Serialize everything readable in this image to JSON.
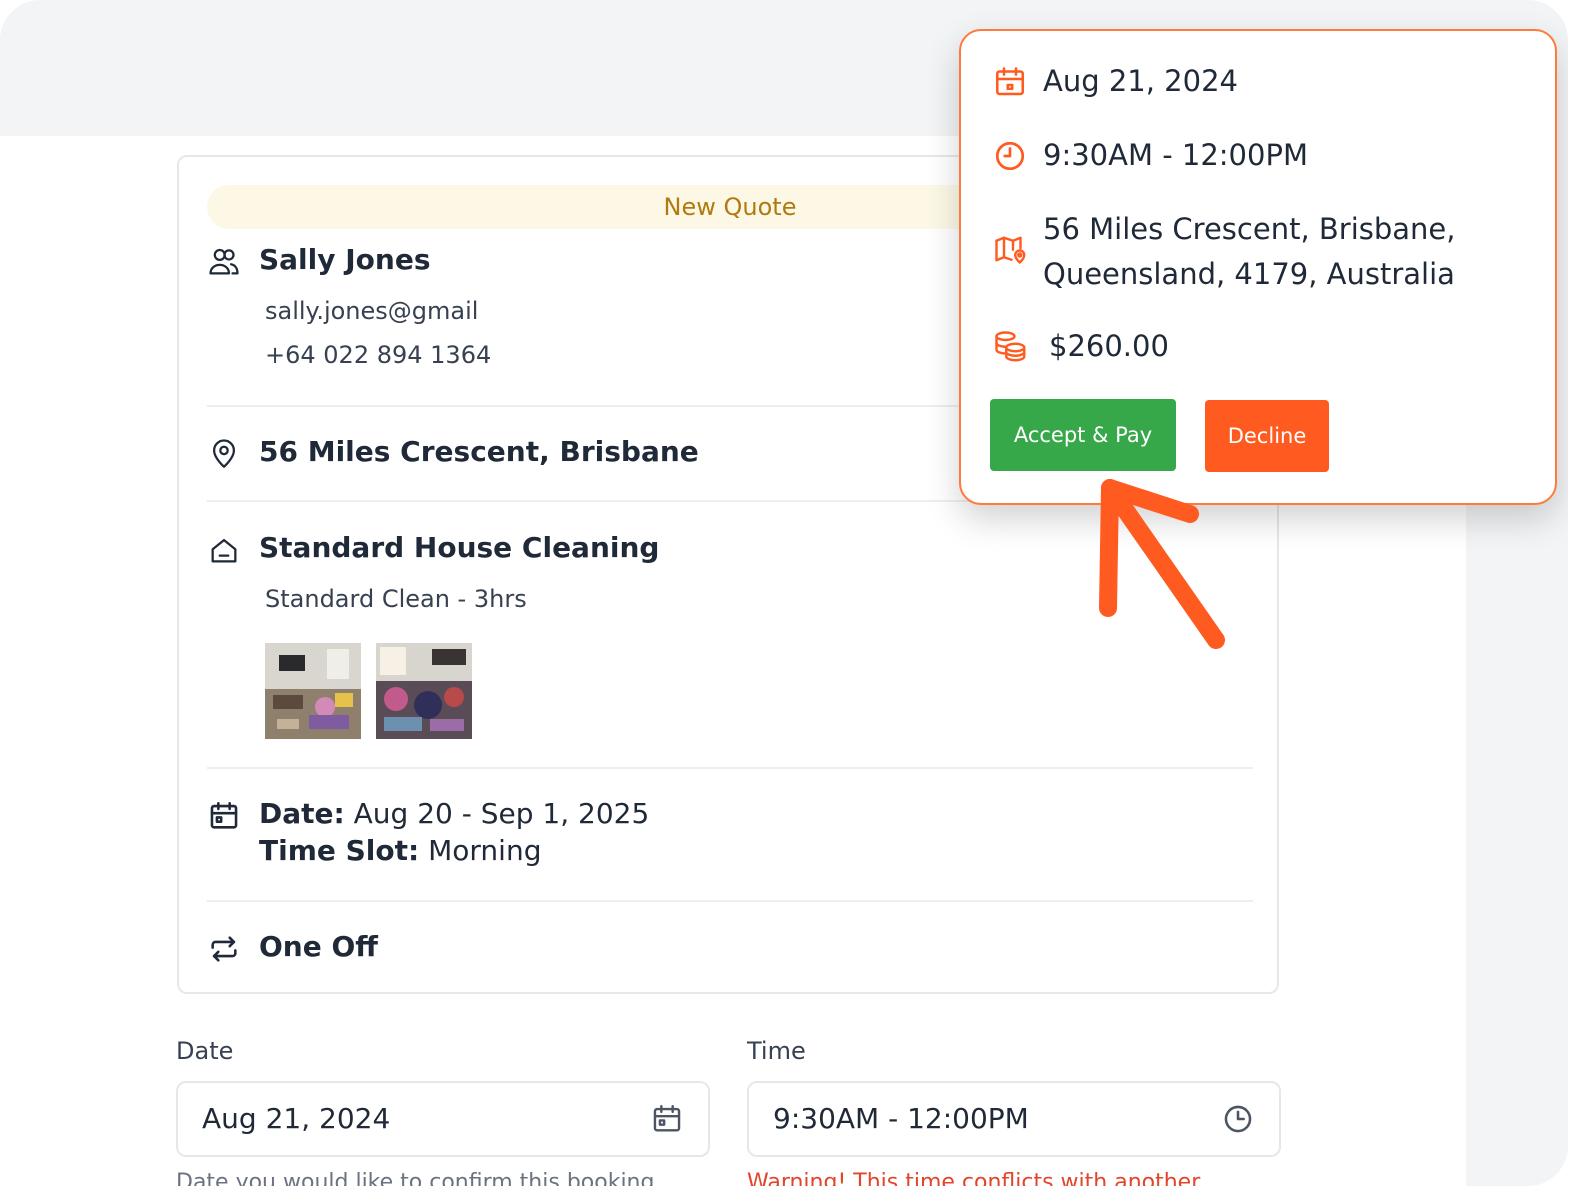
{
  "quote": {
    "status": "New Quote",
    "customer": {
      "name": "Sally Jones",
      "email": "sally.jones@gmail",
      "phone": "+64 022 894 1364"
    },
    "address": "56 Miles Crescent, Brisbane",
    "service": {
      "name": "Standard House Cleaning",
      "detail": "Standard Clean - 3hrs"
    },
    "schedule": {
      "date_label": "Date:",
      "date_value": "Aug 20 - Sep 1, 2025",
      "slot_label": "Time Slot:",
      "slot_value": "Morning"
    },
    "frequency": "One Off"
  },
  "form": {
    "date_label": "Date",
    "date_value": "Aug 21, 2024",
    "date_helper": "Date you would like to confirm this booking",
    "time_label": "Time",
    "time_value": "9:30AM - 12:00PM",
    "time_warning": "Warning! This time conflicts with another"
  },
  "popover": {
    "date": "Aug 21, 2024",
    "time": "9:30AM - 12:00PM",
    "address_line1": "56 Miles Crescent, Brisbane,",
    "address_line2": "Queensland, 4179, Australia",
    "price": "$260.00",
    "accept_label": "Accept & Pay",
    "decline_label": "Decline"
  },
  "colors": {
    "accent": "#ff5a1f",
    "accept": "#37a84a",
    "pill_bg": "#fdf8e6",
    "pill_text": "#b07a10",
    "warning": "#e2452b"
  }
}
